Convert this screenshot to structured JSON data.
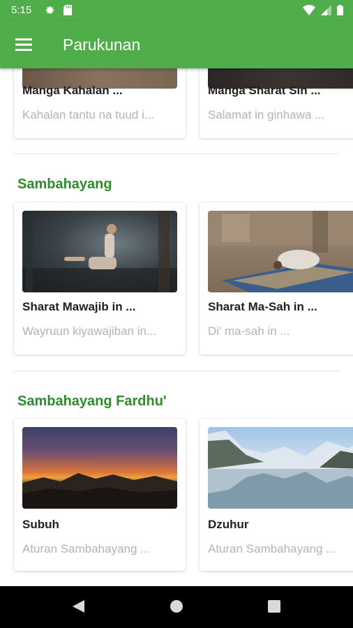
{
  "status_bar": {
    "time": "5:15",
    "left_icons": [
      "gear-icon",
      "sd-card-icon"
    ],
    "right_icons": [
      "wifi-icon",
      "signal-icon",
      "battery-icon"
    ]
  },
  "app_bar": {
    "title": "Parukunan",
    "menu_icon": "hamburger-menu-icon",
    "color": "#4fae4a"
  },
  "top_partial_cards": [
    {
      "title": "Manga Kahalan ...",
      "subtitle": "Kahalan tantu na tuud i..."
    },
    {
      "title": "Manga Sharat Sin ...",
      "subtitle": "Salamat in ginhawa ..."
    }
  ],
  "sections": [
    {
      "title": "Sambahayang",
      "cards": [
        {
          "title": "Sharat Mawajib in ...",
          "subtitle": "Wayruun kiyawajiban in...",
          "image": "kneeling-dancer-photo"
        },
        {
          "title": "Sharat Ma-Sah in ...",
          "subtitle": "Di' ma-sah in ...",
          "image": "prostrating-prayer-photo"
        }
      ]
    },
    {
      "title": "Sambahayang Fardhu'",
      "cards": [
        {
          "title": "Subuh",
          "subtitle": "Aturan Sambahayang ...",
          "image": "dawn-sky-photo"
        },
        {
          "title": "Dzuhur",
          "subtitle": "Aturan Sambahayang ...",
          "image": "mountain-lake-photo"
        }
      ]
    }
  ],
  "colors": {
    "accent": "#4fae4a",
    "section_title": "#2e8b2b",
    "subtitle_text": "#b3b3b3"
  },
  "nav_bar": {
    "buttons": [
      "back-icon",
      "home-icon",
      "recents-icon"
    ]
  }
}
